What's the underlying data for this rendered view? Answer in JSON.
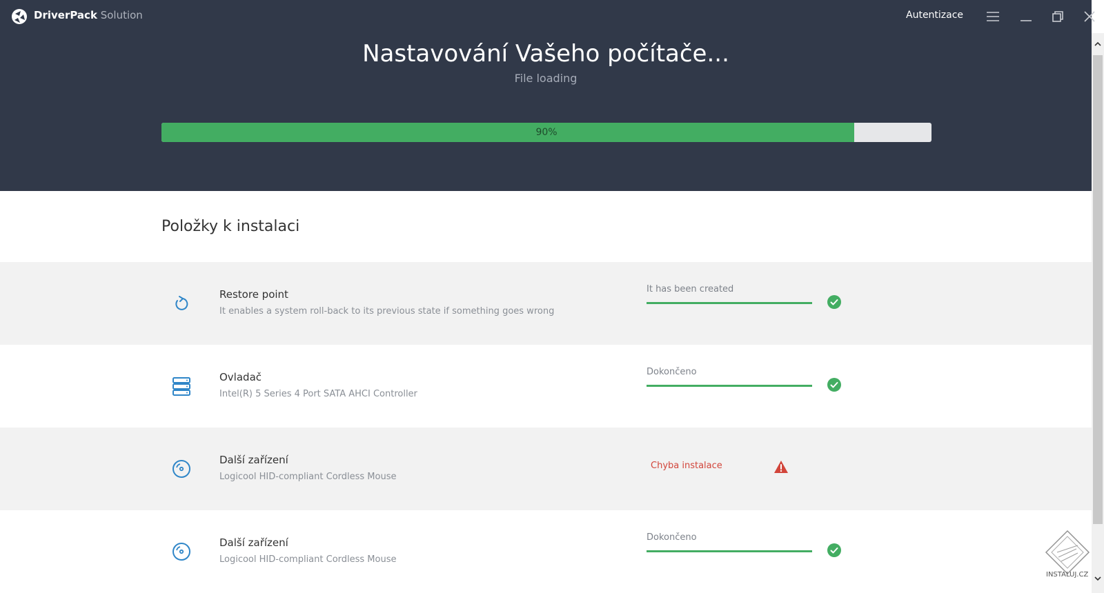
{
  "app": {
    "brand_bold": "DriverPack",
    "brand_light": "Solution",
    "auth_label": "Autentizace"
  },
  "header": {
    "title": "Nastavování Vašeho počítače...",
    "subtitle": "File loading",
    "progress_percent": 90,
    "progress_label": "90%"
  },
  "section": {
    "title": "Položky k instalaci"
  },
  "items": [
    {
      "title": "Restore point",
      "subtitle": "It enables a system roll-back to its previous state if something goes wrong",
      "status": "It has been created",
      "icon": "restore-icon",
      "state": "done"
    },
    {
      "title": "Ovladač",
      "subtitle": "Intel(R) 5 Series 4 Port SATA AHCI Controller",
      "status": "Dokončeno",
      "icon": "server-icon",
      "state": "done"
    },
    {
      "title": "Další zařízení",
      "subtitle": "Logicool HID-compliant Cordless Mouse",
      "status": "Chyba instalace",
      "icon": "disc-icon",
      "state": "error"
    },
    {
      "title": "Další zařízení",
      "subtitle": "Logicool HID-compliant Cordless Mouse",
      "status": "Dokončeno",
      "icon": "disc-icon",
      "state": "done"
    }
  ],
  "watermark": {
    "text": "INSTALUJ.CZ"
  },
  "colors": {
    "header_bg": "#313949",
    "accent_green": "#43ad62",
    "error_red": "#d2453b",
    "icon_blue": "#2f86c8",
    "row_alt_bg": "#f2f2f2"
  }
}
